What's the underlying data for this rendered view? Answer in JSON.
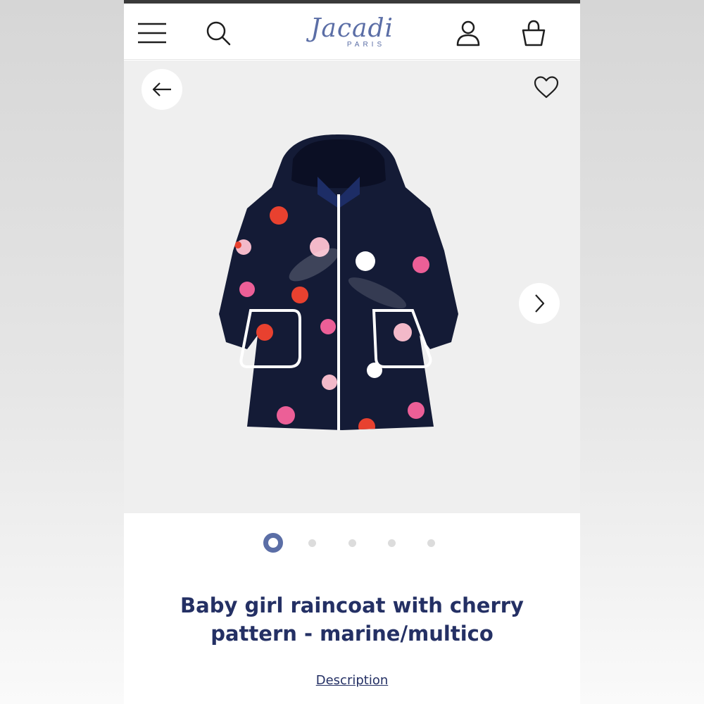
{
  "header": {
    "logo_text": "Jacadi",
    "logo_subtext": "PARIS",
    "icons": [
      "menu-icon",
      "search-icon",
      "account-icon",
      "bag-icon"
    ]
  },
  "gallery": {
    "icons": [
      "arrow-left-icon",
      "heart-icon",
      "chevron-right-icon"
    ],
    "image_count": 5,
    "active_index": 0
  },
  "product": {
    "title": "Baby girl raincoat with cherry pattern - marine/multico",
    "description_link": "Description"
  },
  "colors": {
    "brand": "#5b6ea6",
    "text": "#243064",
    "coat": "#141b36",
    "dot_red": "#e8412f",
    "dot_pink": "#f3b9c9",
    "dot_magenta": "#ec5f97"
  }
}
